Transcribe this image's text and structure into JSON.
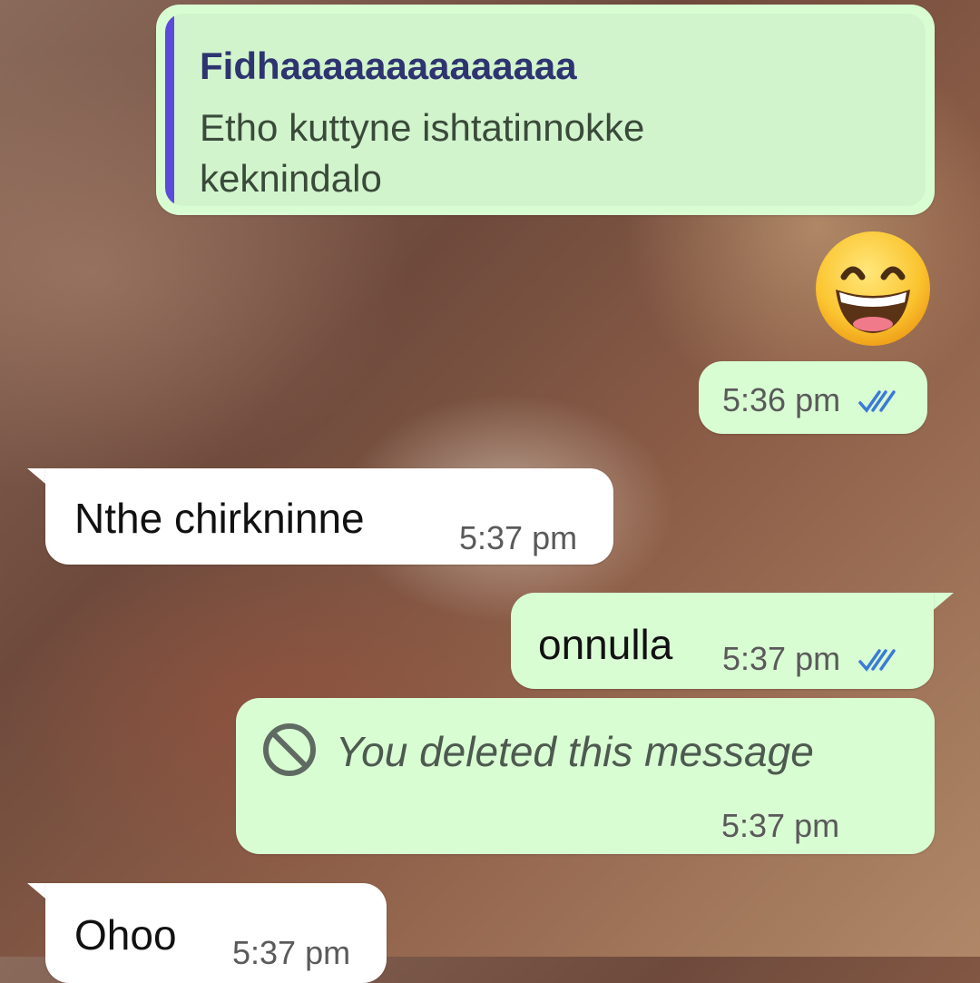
{
  "colors": {
    "outgoing_bubble": "#d9fdd3",
    "incoming_bubble": "#ffffff",
    "quote_bar": "#5b4bdb",
    "read_ticks": "#3b7bd6"
  },
  "messages": {
    "reply": {
      "quoted_author": "Fidhaaaaaaaaaaaaaa",
      "quoted_text": "Etho kuttyne ishtatinnokke keknindalo"
    },
    "emoji_message": {
      "emoji": "grinning-face-with-smiling-eyes",
      "time": "5:36 pm",
      "status": "read"
    },
    "incoming_1": {
      "text": "Nthe chirkninne",
      "time": "5:37 pm"
    },
    "outgoing_1": {
      "text": "onnulla",
      "time": "5:37 pm",
      "status": "read"
    },
    "deleted": {
      "text": "You deleted this message",
      "time": "5:37 pm",
      "icon": "prohibited-icon"
    },
    "incoming_2": {
      "text": "Ohoo",
      "time": "5:37 pm"
    }
  }
}
